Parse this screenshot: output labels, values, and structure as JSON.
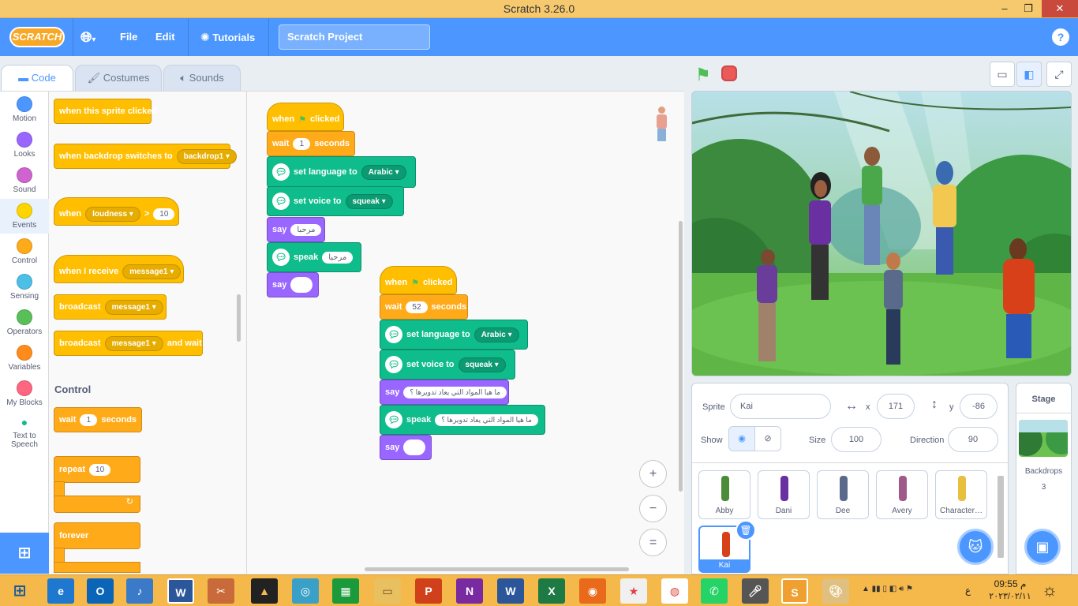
{
  "window": {
    "title": "Scratch 3.26.0",
    "min": "–",
    "max": "❐",
    "close": "✕"
  },
  "menubar": {
    "logo": "SCRATCH",
    "language_icon": "globe-icon",
    "file": "File",
    "edit": "Edit",
    "tutorials": "Tutorials",
    "project_title": "Scratch Project",
    "help": "?"
  },
  "tabs": {
    "code": "Code",
    "costumes": "Costumes",
    "sounds": "Sounds"
  },
  "categories": [
    {
      "label": "Motion",
      "color": "#4c97ff"
    },
    {
      "label": "Looks",
      "color": "#9966ff"
    },
    {
      "label": "Sound",
      "color": "#cf63cf"
    },
    {
      "label": "Events",
      "color": "#ffd500"
    },
    {
      "label": "Control",
      "color": "#ffab19"
    },
    {
      "label": "Sensing",
      "color": "#4cbfe6"
    },
    {
      "label": "Operators",
      "color": "#59c059"
    },
    {
      "label": "Variables",
      "color": "#ff8c1a"
    },
    {
      "label": "My Blocks",
      "color": "#ff6680"
    },
    {
      "label": "Text to Speech",
      "color": "#0fbd8c"
    }
  ],
  "palette": {
    "sprite_clicked": "when this sprite clicked",
    "backdrop_switch": "when backdrop switches to",
    "backdrop_value": "backdrop1",
    "when": "when",
    "loudness": "loudness",
    "gt": ">",
    "loud_value": "10",
    "receive": "when I receive",
    "message": "message1",
    "broadcast": "broadcast",
    "and_wait": "and wait",
    "control_header": "Control",
    "wait": "wait",
    "wait_value": "1",
    "seconds": "seconds",
    "repeat": "repeat",
    "repeat_value": "10",
    "forever": "forever"
  },
  "script1": {
    "when": "when",
    "clicked": "clicked",
    "wait": "wait",
    "wait_value": "1",
    "seconds": "seconds",
    "set_language": "set language to",
    "language": "Arabic",
    "set_voice": "set voice to",
    "voice": "squeak",
    "say": "say",
    "say_value": "مرحبا",
    "speak": "speak",
    "speak_value": "مرحبا",
    "say2": "say"
  },
  "script2": {
    "when": "when",
    "clicked": "clicked",
    "wait": "wait",
    "wait_value": "52",
    "seconds": "seconds",
    "set_language": "set language to",
    "language": "Arabic",
    "set_voice": "set voice to",
    "voice": "squeak",
    "say": "say",
    "say_value": "ما هيا المواد التي يعاد تدويرها ؟",
    "speak": "speak",
    "speak_value": "ما هيا المواد التي يعاد تدويرها ؟",
    "say2": "say"
  },
  "zoom": {
    "in": "+",
    "out": "−",
    "reset": "="
  },
  "sprite_info": {
    "sprite_label": "Sprite",
    "sprite_name": "Kai",
    "x_label": "x",
    "x_value": "171",
    "y_label": "y",
    "y_value": "-86",
    "show_label": "Show",
    "size_label": "Size",
    "size_value": "100",
    "direction_label": "Direction",
    "direction_value": "90"
  },
  "sprites": [
    {
      "name": "Abby",
      "color": "#4a8c3a"
    },
    {
      "name": "Dani",
      "color": "#6a2fa0"
    },
    {
      "name": "Dee",
      "color": "#5a6a8a"
    },
    {
      "name": "Avery",
      "color": "#a05a8a"
    },
    {
      "name": "Character…",
      "color": "#e8c040"
    },
    {
      "name": "Kai",
      "color": "#d8401a"
    }
  ],
  "stage_panel": {
    "title": "Stage",
    "backdrops_label": "Backdrops",
    "backdrops_count": "3"
  },
  "taskbar": {
    "time": "09:55 م",
    "date": "٢٠٢٣/٠٢/١١",
    "lang": "ع"
  }
}
